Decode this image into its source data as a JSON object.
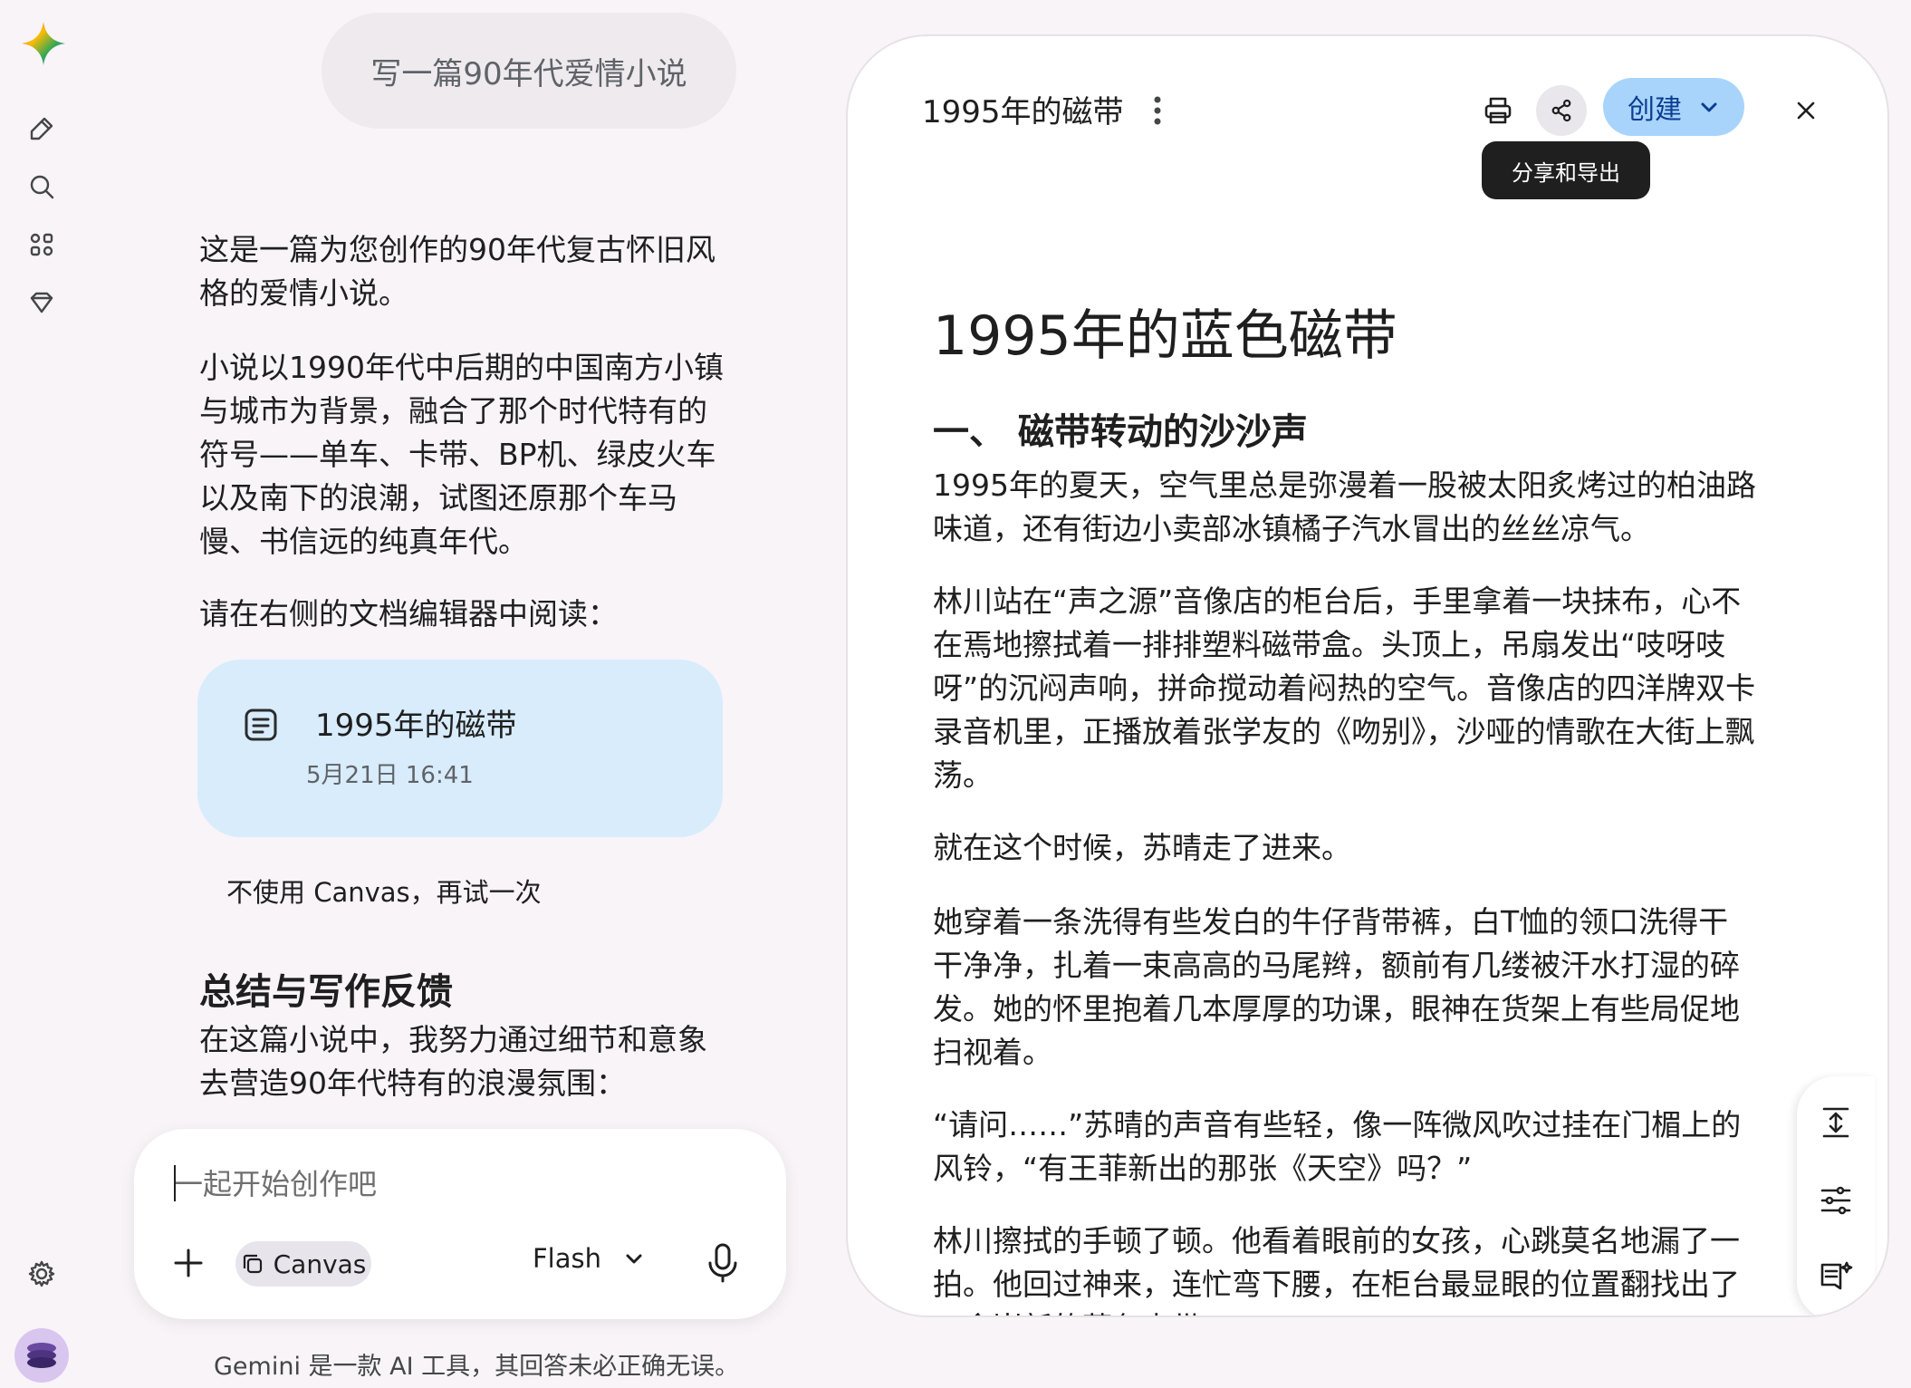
{
  "sidebar": {
    "logo": "gemini-spark-icon",
    "icons": [
      "new-chat-icon",
      "search-icon",
      "apps-icon",
      "gem-icon"
    ],
    "settings_icon": "gear-icon"
  },
  "chat": {
    "user_prompt": "写一篇90年代爱情小说",
    "response_intro": "这是一篇为您创作的90年代复古怀旧风格的爱情小说。",
    "response_body": "小说以1990年代中后期的中国南方小镇与城市为背景，融合了那个时代特有的符号——单车、卡带、BP机、绿皮火车以及南下的浪潮，试图还原那个车马慢、书信远的纯真年代。",
    "read_prompt": "请在右侧的文档编辑器中阅读：",
    "doc_card": {
      "title": "1995年的磁带",
      "date": "5月21日 16:41"
    },
    "retry_text": "不使用 Canvas，再试一次",
    "summary_heading": "总结与写作反馈",
    "summary_text": "在这篇小说中，我努力通过细节和意象去营造90年代特有的浪漫氛围："
  },
  "input": {
    "placeholder": "一起开始创作吧",
    "canvas_label": "Canvas",
    "model_label": "Flash"
  },
  "footer": {
    "disclaimer": "Gemini 是一款 AI 工具，其回答未必正确无误。"
  },
  "editor": {
    "title": "1995年的磁带",
    "create_label": "创建",
    "share_tooltip": "分享和导出",
    "doc_title": "1995年的蓝色磁带",
    "section_heading": "一、 磁带转动的沙沙声",
    "paragraphs": [
      "1995年的夏天，空气里总是弥漫着一股被太阳炙烤过的柏油路味道，还有街边小卖部冰镇橘子汽水冒出的丝丝凉气。",
      "林川站在“声之源”音像店的柜台后，手里拿着一块抹布，心不在焉地擦拭着一排排塑料磁带盒。头顶上，吊扇发出“吱呀吱呀”的沉闷声响，拼命搅动着闷热的空气。音像店的四洋牌双卡录音机里，正播放着张学友的《吻别》，沙哑的情歌在大街上飘荡。",
      "就在这个时候，苏晴走了进来。",
      "她穿着一条洗得有些发白的牛仔背带裤，白T恤的领口洗得干干净净，扎着一束高高的马尾辫，额前有几缕被汗水打湿的碎发。她的怀里抱着几本厚厚的功课，眼神在货架上有些局促地扫视着。",
      "“请问……”苏晴的声音有些轻，像一阵微风吹过挂在门楣上的风铃，“有王菲新出的那张《天空》吗？”",
      "林川擦拭的手顿了顿。他看着眼前的女孩，心跳莫名地漏了一拍。他回过神来，连忙弯下腰，在柜台最显眼的位置翻找出了一盒崭新的蓝色卡带。"
    ]
  }
}
